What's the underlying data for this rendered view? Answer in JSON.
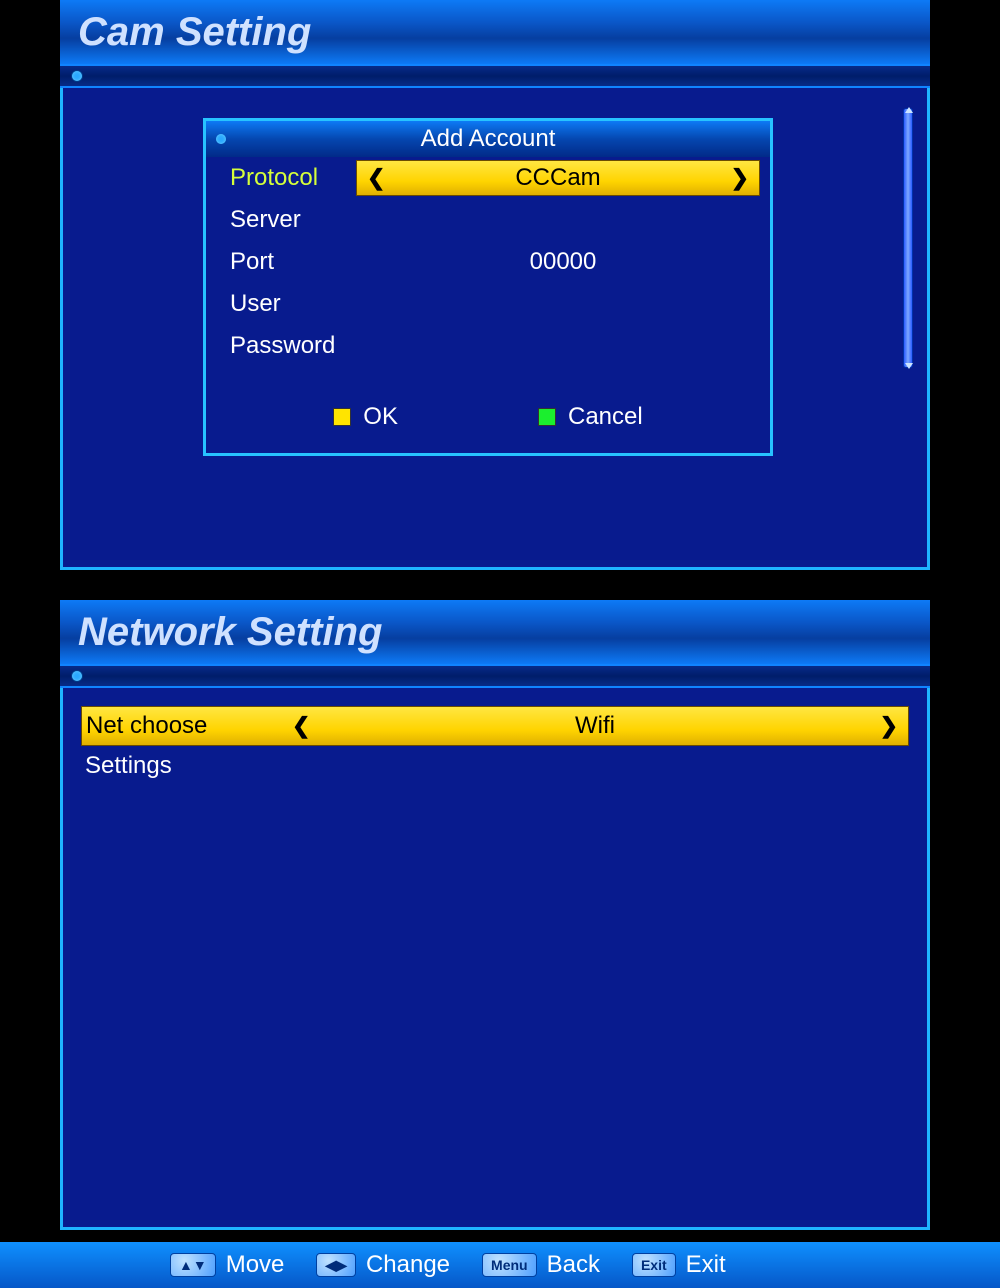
{
  "cam_panel": {
    "title": "Cam Setting",
    "dialog": {
      "title": "Add Account",
      "rows": {
        "protocol": {
          "label": "Protocol",
          "value": "CCCam"
        },
        "server": {
          "label": "Server",
          "value": ""
        },
        "port": {
          "label": "Port",
          "value": "00000"
        },
        "user": {
          "label": "User",
          "value": ""
        },
        "password": {
          "label": "Password",
          "value": ""
        }
      },
      "actions": {
        "ok": "OK",
        "cancel": "Cancel"
      }
    }
  },
  "net_panel": {
    "title": "Network Setting",
    "rows": {
      "netchoose": {
        "label": "Net choose",
        "value": "Wifi"
      },
      "settings": {
        "label": "Settings"
      }
    }
  },
  "footer": {
    "move": {
      "key": "▲▼",
      "label": "Move"
    },
    "change": {
      "key": "◀▶",
      "label": "Change"
    },
    "back": {
      "key": "Menu",
      "label": "Back"
    },
    "exit": {
      "key": "Exit",
      "label": "Exit"
    }
  }
}
